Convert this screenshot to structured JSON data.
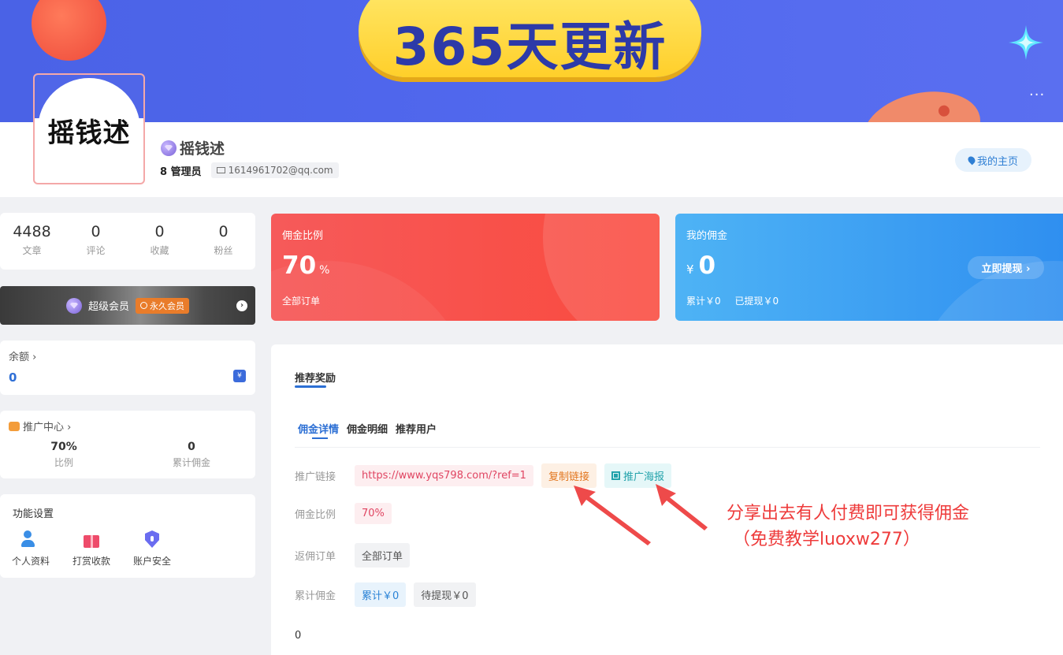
{
  "banner": {
    "headline": "365天更新",
    "more": "···"
  },
  "profile": {
    "avatar_text": "摇钱述",
    "name": "摇钱述",
    "role": "8 管理员",
    "email": "1614961702@qq.com",
    "home_label": "我的主页"
  },
  "stats": [
    {
      "value": "4488",
      "label": "文章"
    },
    {
      "value": "0",
      "label": "评论"
    },
    {
      "value": "0",
      "label": "收藏"
    },
    {
      "value": "0",
      "label": "粉丝"
    }
  ],
  "vip": {
    "label": "超级会员",
    "badge": "永久会员"
  },
  "balance": {
    "title": "余额 ›",
    "value": "0",
    "icon_glyph": "¥"
  },
  "promo": {
    "title": "推广中心 ›",
    "ratio_value": "70%",
    "ratio_label": "比例",
    "total_value": "0",
    "total_label": "累计佣金"
  },
  "functions": {
    "title": "功能设置",
    "items": [
      {
        "label": "个人资料",
        "icon": "user-icon"
      },
      {
        "label": "打赏收款",
        "icon": "gift-icon"
      },
      {
        "label": "账户安全",
        "icon": "shield-icon"
      }
    ]
  },
  "commission_card": {
    "title": "佣金比例",
    "value": "70",
    "unit": "%",
    "footer": "全部订单"
  },
  "my_commission": {
    "title": "我的佣金",
    "prefix": "¥",
    "value": "0",
    "total": "累计￥0",
    "withdrawn": "已提现￥0",
    "withdraw_btn": "立即提现 ›"
  },
  "panel": {
    "title": "推荐奖励",
    "tabs": [
      "佣金详情",
      "佣金明细",
      "推荐用户"
    ],
    "rows": {
      "link_label": "推广链接",
      "link_value": "https://www.yqs798.com/?ref=1",
      "copy_btn": "复制链接",
      "poster_btn": "推广海报",
      "ratio_label": "佣金比例",
      "ratio_value": "70%",
      "orders_label": "返佣订单",
      "orders_value": "全部订单",
      "total_label": "累计佣金",
      "total_value": "累计￥0",
      "pending_value": "待提现￥0"
    },
    "footer_value": "0"
  },
  "annotation": {
    "line1": "分享出去有人付费即可获得佣金",
    "line2": "（免费教学luoxw277）",
    "color": "#ee3b3b"
  }
}
